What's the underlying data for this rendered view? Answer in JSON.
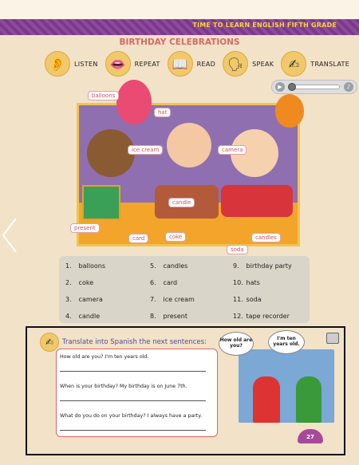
{
  "header": {
    "series_title": "TIME TO LEARN ENGLISH FIFTH GRADE",
    "lesson_title": "BIRTHDAY CELEBRATIONS"
  },
  "actions": [
    {
      "label": "LISTEN",
      "icon": "ear-icon"
    },
    {
      "label": "REPEAT",
      "icon": "mouth-icon"
    },
    {
      "label": "READ",
      "icon": "book-icon"
    },
    {
      "label": "SPEAK",
      "icon": "speaking-kids-icon"
    },
    {
      "label": "TRANSLATE",
      "icon": "writing-hand-icon"
    }
  ],
  "audio_player": {
    "progress": 0.05
  },
  "scene_labels": {
    "balloons": "balloons",
    "hat": "hat",
    "ice_cream": "ice cream",
    "camera": "camera",
    "candle": "candle",
    "present": "present",
    "card": "card",
    "coke": "coke",
    "soda": "soda",
    "candles": "candles"
  },
  "vocabulary": [
    {
      "num": "1.",
      "word": "balloons"
    },
    {
      "num": "2.",
      "word": "coke"
    },
    {
      "num": "3.",
      "word": "camera"
    },
    {
      "num": "4.",
      "word": "candle"
    },
    {
      "num": "5.",
      "word": "candles"
    },
    {
      "num": "6.",
      "word": "card"
    },
    {
      "num": "7.",
      "word": "ice cream"
    },
    {
      "num": "8.",
      "word": "present"
    },
    {
      "num": "9.",
      "word": "birthday party"
    },
    {
      "num": "10.",
      "word": "hats"
    },
    {
      "num": "11.",
      "word": "soda"
    },
    {
      "num": "12.",
      "word": "tape recorder"
    }
  ],
  "exercise": {
    "instruction": "Translate into Spanish the next sentences:",
    "sentences": [
      "How old are you?    I'm ten years old.",
      "When is your birthday?    My birthday is on June 7th.",
      "What do you do on your birthday?    I always have a party."
    ],
    "bubble_left": "How old are you?",
    "bubble_right": "I'm ten years old.",
    "page_number": "27"
  },
  "colors": {
    "header_strip": "#7a3a8a",
    "title_pink": "#d46a6a",
    "instruction_blue": "#4a4f9a"
  }
}
